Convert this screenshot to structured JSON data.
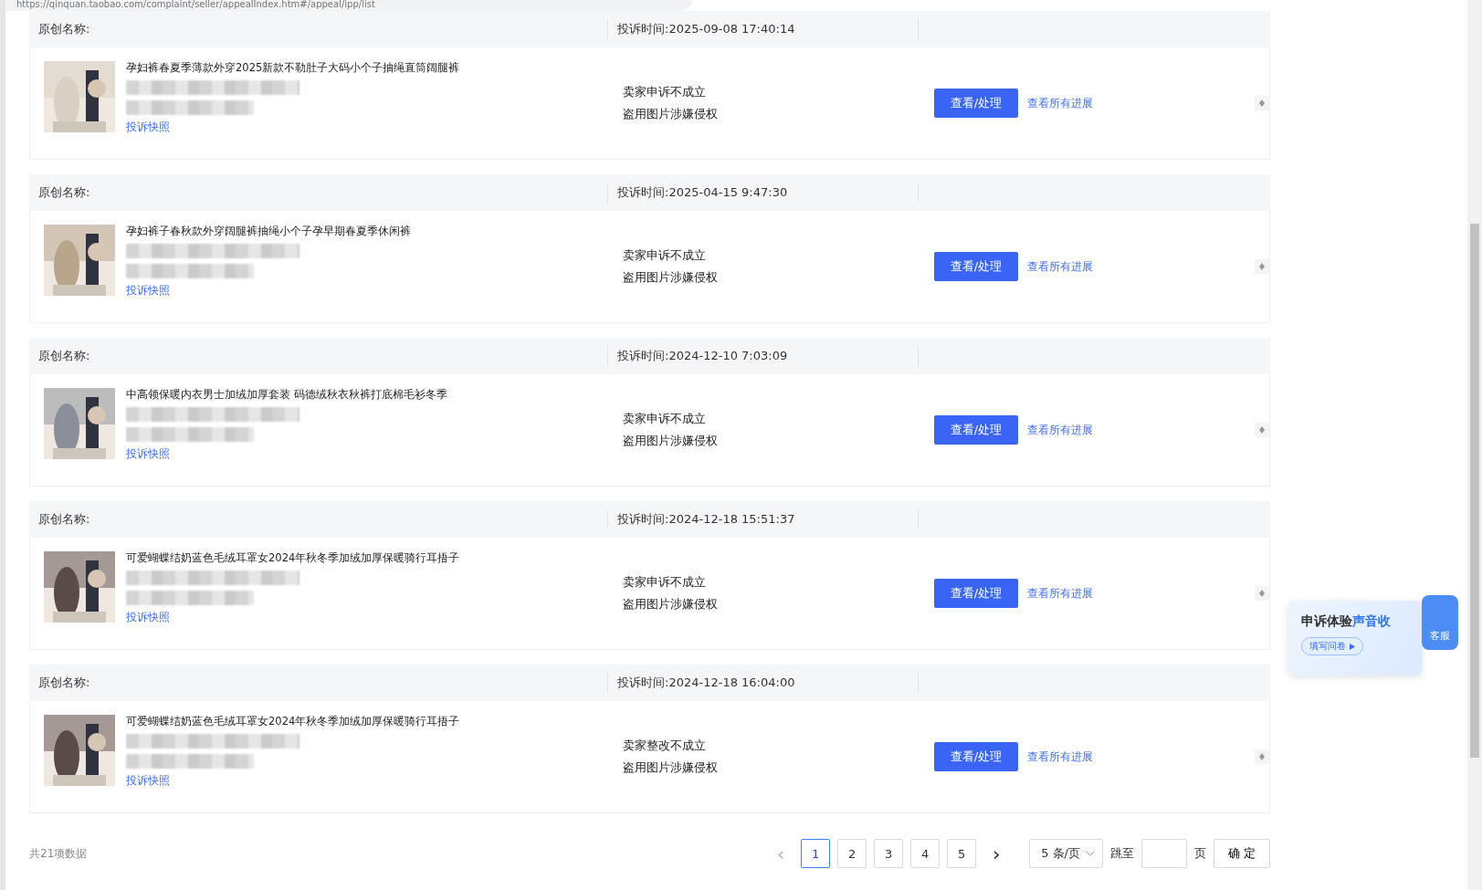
{
  "address_bar": {
    "url": "https://qinquan.taobao.com/complaint/seller/appealIndex.htm#/appeal/ipp/list"
  },
  "complaints": [
    {
      "name_label": "原创名称:",
      "time": "投诉时间:2025-09-08 17:40:14",
      "title": "孕妇裤春夏季薄款外穿2025新款不勒肚子大码小个子抽绳直筒阔腿裤",
      "snapshot": "投诉快照",
      "result": "卖家申诉不成立",
      "reason": "盗用图片涉嫌侵权",
      "action": "查看/处理",
      "progress": "查看所有进展"
    },
    {
      "name_label": "原创名称:",
      "time": "投诉时间:2025-04-15 9:47:30",
      "title": "孕妇裤子春秋款外穿阔腿裤抽绳小个子孕早期春夏季休闲裤",
      "snapshot": "投诉快照",
      "result": "卖家申诉不成立",
      "reason": "盗用图片涉嫌侵权",
      "action": "查看/处理",
      "progress": "查看所有进展"
    },
    {
      "name_label": "原创名称:",
      "time": "投诉时间:2024-12-10 7:03:09",
      "title": "中高领保暖内衣男士加绒加厚套装 码德绒秋衣秋裤打底棉毛衫冬季",
      "snapshot": "投诉快照",
      "result": "卖家申诉不成立",
      "reason": "盗用图片涉嫌侵权",
      "action": "查看/处理",
      "progress": "查看所有进展"
    },
    {
      "name_label": "原创名称:",
      "time": "投诉时间:2024-12-18 15:51:37",
      "title": "可爱蝴蝶结奶蓝色毛绒耳罩女2024年秋冬季加绒加厚保暖骑行耳捂子",
      "snapshot": "投诉快照",
      "result": "卖家申诉不成立",
      "reason": "盗用图片涉嫌侵权",
      "action": "查看/处理",
      "progress": "查看所有进展"
    },
    {
      "name_label": "原创名称:",
      "time": "投诉时间:2024-12-18 16:04:00",
      "title": "可爱蝴蝶结奶蓝色毛绒耳罩女2024年秋冬季加绒加厚保暖骑行耳捂子",
      "snapshot": "投诉快照",
      "result": "卖家整改不成立",
      "reason": "盗用图片涉嫌侵权",
      "action": "查看/处理",
      "progress": "查看所有进展"
    }
  ],
  "footer": {
    "total": "共21项数据"
  },
  "pagination": {
    "prev": "‹",
    "next": "›",
    "pages": [
      {
        "label": "1",
        "selected": true
      },
      {
        "label": "2",
        "selected": false
      },
      {
        "label": "3",
        "selected": false
      },
      {
        "label": "4",
        "selected": false
      },
      {
        "label": "5",
        "selected": false
      }
    ],
    "page_size": "5 条/页",
    "jump_label": "跳至",
    "page_unit": "页",
    "confirm": "确 定"
  },
  "survey_widget": {
    "title_dark": "申诉体验",
    "title_blue": "声音收",
    "button": "填写问卷",
    "service": "客服"
  }
}
